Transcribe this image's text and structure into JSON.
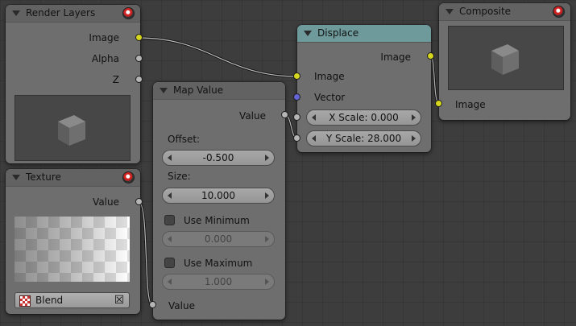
{
  "render_layers": {
    "title": "Render Layers",
    "outputs": {
      "image": "Image",
      "alpha": "Alpha",
      "z": "Z"
    }
  },
  "texture": {
    "title": "Texture",
    "outputs": {
      "value": "Value"
    },
    "texture_name": "Blend"
  },
  "map_value": {
    "title": "Map Value",
    "output_value": "Value",
    "offset_label": "Offset:",
    "offset_value": "-0.500",
    "size_label": "Size:",
    "size_value": "10.000",
    "use_min_label": "Use Minimum",
    "min_value": "0.000",
    "use_max_label": "Use Maximum",
    "max_value": "1.000",
    "input_value": "Value"
  },
  "displace": {
    "title": "Displace",
    "output_image": "Image",
    "input_image": "Image",
    "input_vector": "Vector",
    "x_scale": "X Scale: 0.000",
    "y_scale": "Y Scale: 28.000"
  },
  "composite": {
    "title": "Composite",
    "input_image": "Image"
  },
  "colors": {
    "background": "#3d3d3d",
    "node_body": "#6e6e6e",
    "displace_header": "#6e9a9b",
    "socket_color": "#d6d61e",
    "socket_value": "#b5b5b5",
    "socket_vector": "#6464d8"
  }
}
